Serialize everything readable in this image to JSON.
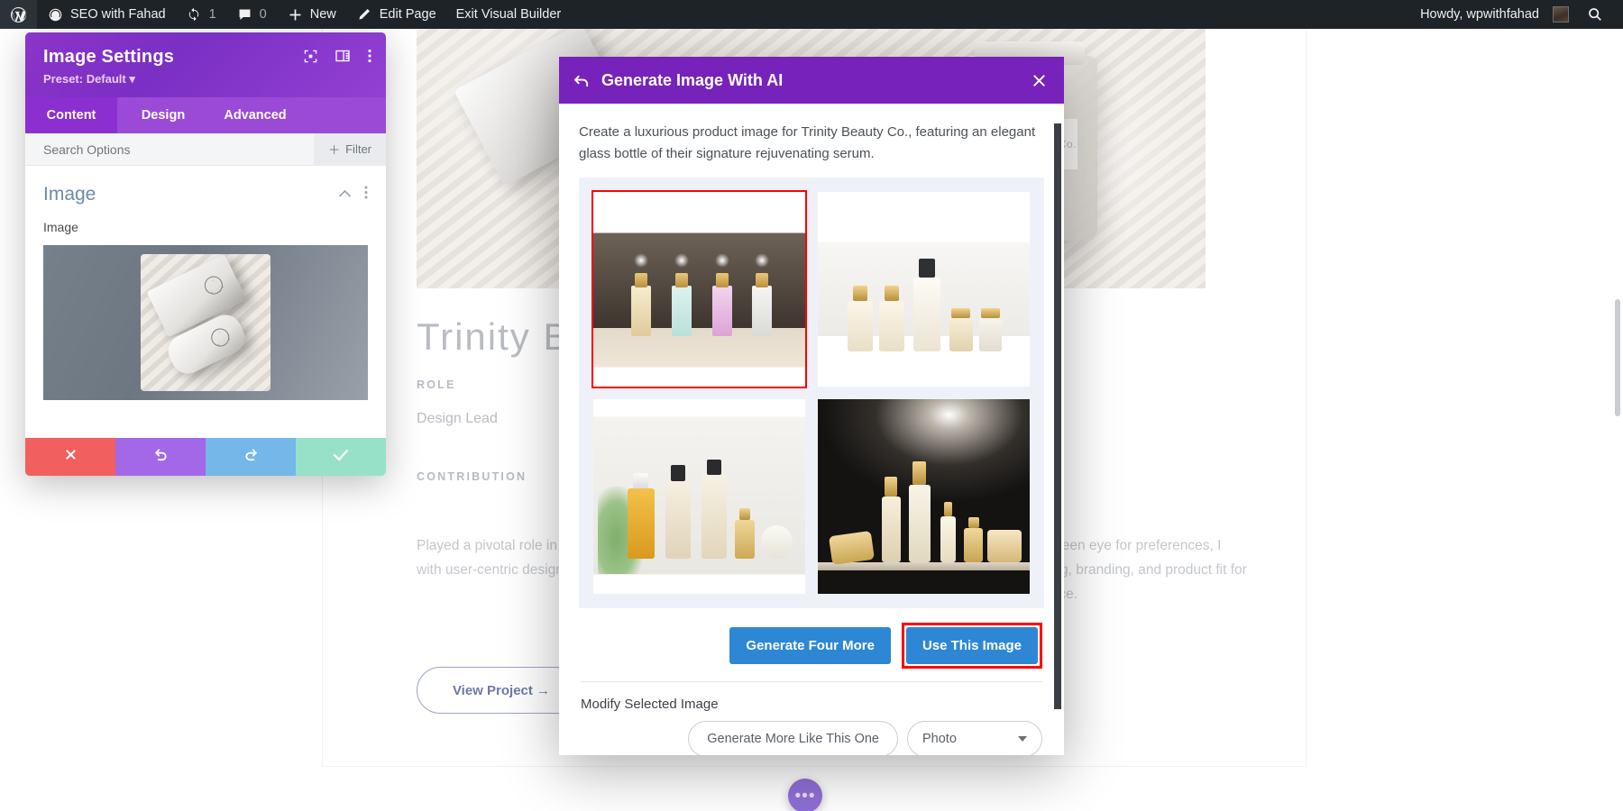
{
  "adminbar": {
    "logo_icon": "wordpress-logo-icon",
    "site_icon": "dashboard-icon",
    "site_name": "SEO with Fahad",
    "updates_icon": "updates-icon",
    "updates_count": "1",
    "comments_icon": "comment-bubble-icon",
    "comments_count": "0",
    "new_icon": "plus-icon",
    "new_label": "New",
    "edit_icon": "pencil-icon",
    "edit_label": "Edit Page",
    "exit_label": "Exit Visual Builder",
    "howdy": "Howdy, wpwithfahad",
    "avatar_icon": "avatar",
    "search_icon": "search-icon"
  },
  "divi_panel": {
    "title": "Image Settings",
    "preset_label": "Preset: Default",
    "preset_caret": "caret-down-icon",
    "header_icons": [
      "fullscreen-icon",
      "layout-columns-icon",
      "kebab-menu-icon"
    ],
    "tabs": [
      {
        "label": "Content",
        "active": true
      },
      {
        "label": "Design",
        "active": false
      },
      {
        "label": "Advanced",
        "active": false
      }
    ],
    "search_placeholder": "Search Options",
    "search_value": "",
    "filter_label": "Filter",
    "filter_icon": "plus-icon",
    "section_title": "Image",
    "section_collapse_icon": "chevron-up-icon",
    "section_menu_icon": "kebab-menu-icon",
    "field_label": "Image",
    "image_alt": "product-thumbnail-preview",
    "actions": [
      {
        "name": "cancel",
        "icon": "close-x-icon",
        "color": "#f15f5f"
      },
      {
        "name": "undo",
        "icon": "undo-arrow-icon",
        "color": "#a368e8"
      },
      {
        "name": "redo",
        "icon": "redo-arrow-icon",
        "color": "#74b7e8"
      },
      {
        "name": "save",
        "icon": "checkmark-icon",
        "color": "#97e1c9"
      }
    ]
  },
  "ai_modal": {
    "back_icon": "back-arrow-icon",
    "title": "Generate Image With AI",
    "close_icon": "close-x-icon",
    "prompt": "Create a luxurious product image for Trinity Beauty Co., featuring an elegant glass bottle of their signature rejuvenating serum.",
    "results": [
      {
        "id": "result-1",
        "alt": "four-pastel-serum-bottles-on-dark-backdrop",
        "selected": true
      },
      {
        "id": "result-2",
        "alt": "gold-capped-bottles-on-bright-white-shelf",
        "selected": false
      },
      {
        "id": "result-3",
        "alt": "amber-oil-and-gold-pump-bottles-with-plant",
        "selected": false
      },
      {
        "id": "result-4",
        "alt": "gold-luxury-skincare-set-on-black-backdrop",
        "selected": false
      }
    ],
    "generate_more_label": "Generate Four More",
    "use_image_label": "Use This Image",
    "modify_label": "Modify Selected Image",
    "generate_like_label": "Generate More Like This One",
    "style_select_value": "Photo",
    "style_select_caret": "caret-down-icon",
    "highlight_color": "#ff0000",
    "accent_color": "#2e87d4",
    "header_color": "#7722bb"
  },
  "page": {
    "hero_alt": "trinity-beauty-hero-product-photo",
    "title": "Trinity Beauty Co.",
    "role_label": "ROLE",
    "role_value": "Design Lead",
    "contribution_label": "CONTRIBUTION",
    "paragraph_left": "Played a pivotal role in shaping the user experience of our product, blending flair with user-centric design across every aspect of Trinity Beauty Co.",
    "paragraph_right": "decisions and a keen eye for preferences, I crafted messaging, branding, and product fit for the target audience.",
    "view_project_label": "View Project →",
    "fab_icon": "kebab-menu-icon"
  }
}
